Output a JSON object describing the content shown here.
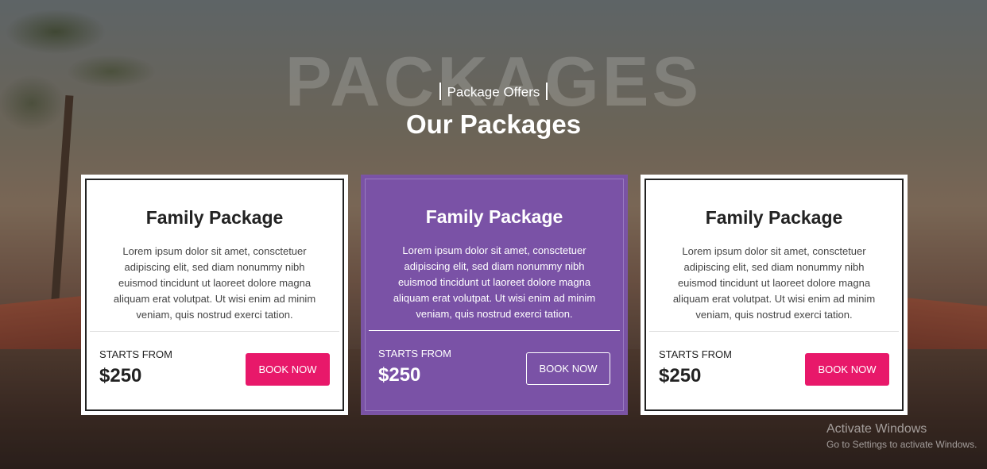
{
  "section": {
    "watermark": "PACKAGES",
    "eyebrow": "Package Offers",
    "title": "Our Packages"
  },
  "packages": [
    {
      "title": "Family Package",
      "description": "Lorem ipsum dolor sit amet, consctetuer adipiscing elit, sed diam nonummy nibh euismod tincidunt ut laoreet dolore magna aliquam erat volutpat. Ut wisi enim ad minim veniam, quis nostrud exerci tation.",
      "starts_label": "STARTS FROM",
      "price": "$250",
      "button_label": "BOOK NOW"
    },
    {
      "title": "Family Package",
      "description": "Lorem ipsum dolor sit amet, consctetuer adipiscing elit, sed diam nonummy nibh euismod tincidunt ut laoreet dolore magna aliquam erat volutpat. Ut wisi enim ad minim veniam, quis nostrud exerci tation.",
      "starts_label": "STARTS FROM",
      "price": "$250",
      "button_label": "BOOK NOW"
    },
    {
      "title": "Family Package",
      "description": "Lorem ipsum dolor sit amet, consctetuer adipiscing elit, sed diam nonummy nibh euismod tincidunt ut laoreet dolore magna aliquam erat volutpat. Ut wisi enim ad minim veniam, quis nostrud exerci tation.",
      "starts_label": "STARTS FROM",
      "price": "$250",
      "button_label": "BOOK NOW"
    }
  ],
  "windows_watermark": {
    "line1": "Activate Windows",
    "line2": "Go to Settings to activate Windows."
  },
  "colors": {
    "accent_pink": "#e8186a",
    "featured_purple": "#7a52a6"
  }
}
